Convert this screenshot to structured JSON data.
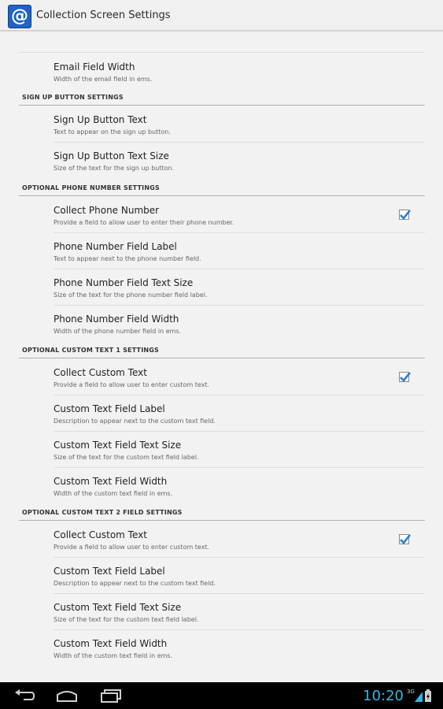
{
  "app": {
    "title": "Collection Screen Settings",
    "icon_glyph": "@",
    "icon_name": "at-sign-app-icon",
    "accent_color": "#33b5e5",
    "checkbox_color": "#2a7fc9"
  },
  "items": {
    "email_width": {
      "title": "Email Field Width",
      "summary": "Width of the email field in ems."
    },
    "signup_text": {
      "title": "Sign Up Button Text",
      "summary": "Text to appear on the sign up button."
    },
    "signup_size": {
      "title": "Sign Up Button Text Size",
      "summary": "Size of the text for the sign up button."
    },
    "collect_phone": {
      "title": "Collect Phone Number",
      "summary": "Provide a field to allow user to enter their phone number.",
      "checked": true
    },
    "phone_label": {
      "title": "Phone Number Field Label",
      "summary": "Text to appear next to the phone number field."
    },
    "phone_size": {
      "title": "Phone Number Field Text Size",
      "summary": "Size of the text for the phone number field label."
    },
    "phone_width": {
      "title": "Phone Number Field Width",
      "summary": "Width of the phone number field in ems."
    },
    "ct1_collect": {
      "title": "Collect Custom Text",
      "summary": "Provide a field to allow user to enter custom text.",
      "checked": true
    },
    "ct1_label": {
      "title": "Custom Text Field Label",
      "summary": "Description to appear next to the custom text field."
    },
    "ct1_size": {
      "title": "Custom Text Field Text Size",
      "summary": "Size of the text for the custom text field label."
    },
    "ct1_width": {
      "title": "Custom Text Field Width",
      "summary": "Width of the custom text field in ems."
    },
    "ct2_collect": {
      "title": "Collect Custom Text",
      "summary": "Provide a field to allow user to enter custom text.",
      "checked": true
    },
    "ct2_label": {
      "title": "Custom Text Field Label",
      "summary": "Description to appear next to the custom text field."
    },
    "ct2_size": {
      "title": "Custom Text Field Text Size",
      "summary": "Size of the text for the custom text field label."
    },
    "ct2_width": {
      "title": "Custom Text Field Width",
      "summary": "Width of the custom text field in ems."
    }
  },
  "sections": {
    "signup": "SIGN UP BUTTON SETTINGS",
    "phone": "OPTIONAL PHONE NUMBER SETTINGS",
    "custom1": "OPTIONAL CUSTOM TEXT 1 SETTINGS",
    "custom2": "OPTIONAL CUSTOM TEXT 2 FIELD SETTINGS"
  },
  "status_bar": {
    "time": "10:20",
    "network": "3G",
    "icons": [
      "back-icon",
      "home-icon",
      "recent-apps-icon",
      "signal-icon",
      "battery-icon"
    ]
  }
}
